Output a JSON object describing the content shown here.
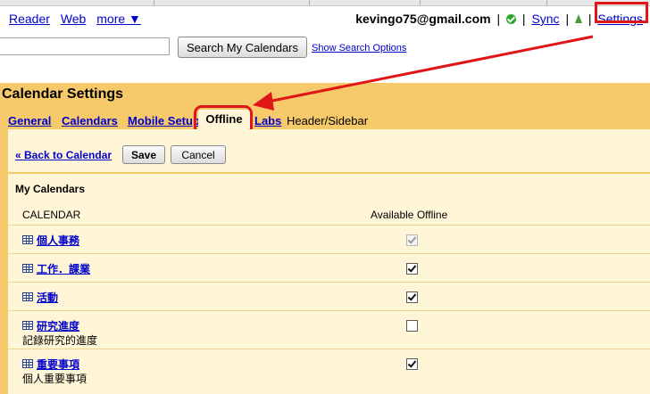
{
  "topnav": {
    "links": [
      {
        "label": "Reader"
      },
      {
        "label": "Web"
      },
      {
        "label": "more ▼"
      }
    ],
    "email": "kevingo75@gmail.com",
    "sync": "Sync",
    "settings": "Settings",
    "separator": "|"
  },
  "search": {
    "value": "",
    "button": "Search My Calendars",
    "options_link": "Show Search Options"
  },
  "settings": {
    "title": "Calendar Settings",
    "tabs": [
      {
        "label": "General",
        "type": "link"
      },
      {
        "label": "Calendars",
        "type": "link"
      },
      {
        "label": "Mobile Setup",
        "type": "link"
      },
      {
        "label": "Offline",
        "type": "active"
      },
      {
        "label": "Labs",
        "type": "link"
      },
      {
        "label": "Header/Sidebar",
        "type": "plain"
      }
    ]
  },
  "actions": {
    "back": "« Back to Calendar",
    "save": "Save",
    "cancel": "Cancel"
  },
  "calendars_section": {
    "title": "My Calendars",
    "col_calendar": "CALENDAR",
    "col_offline": "Available Offline",
    "rows": [
      {
        "name": "個人事務",
        "desc": "",
        "checked": true,
        "disabled": true
      },
      {
        "name": "工作．課業",
        "desc": "",
        "checked": true,
        "disabled": false
      },
      {
        "name": "活動",
        "desc": "",
        "checked": true,
        "disabled": false
      },
      {
        "name": "研究進度",
        "desc": "記錄研究的進度",
        "checked": false,
        "disabled": false
      },
      {
        "name": "重要事項",
        "desc": "個人重要事項",
        "checked": true,
        "disabled": false
      }
    ]
  },
  "annotation": {
    "highlight_color": "#e01515"
  }
}
